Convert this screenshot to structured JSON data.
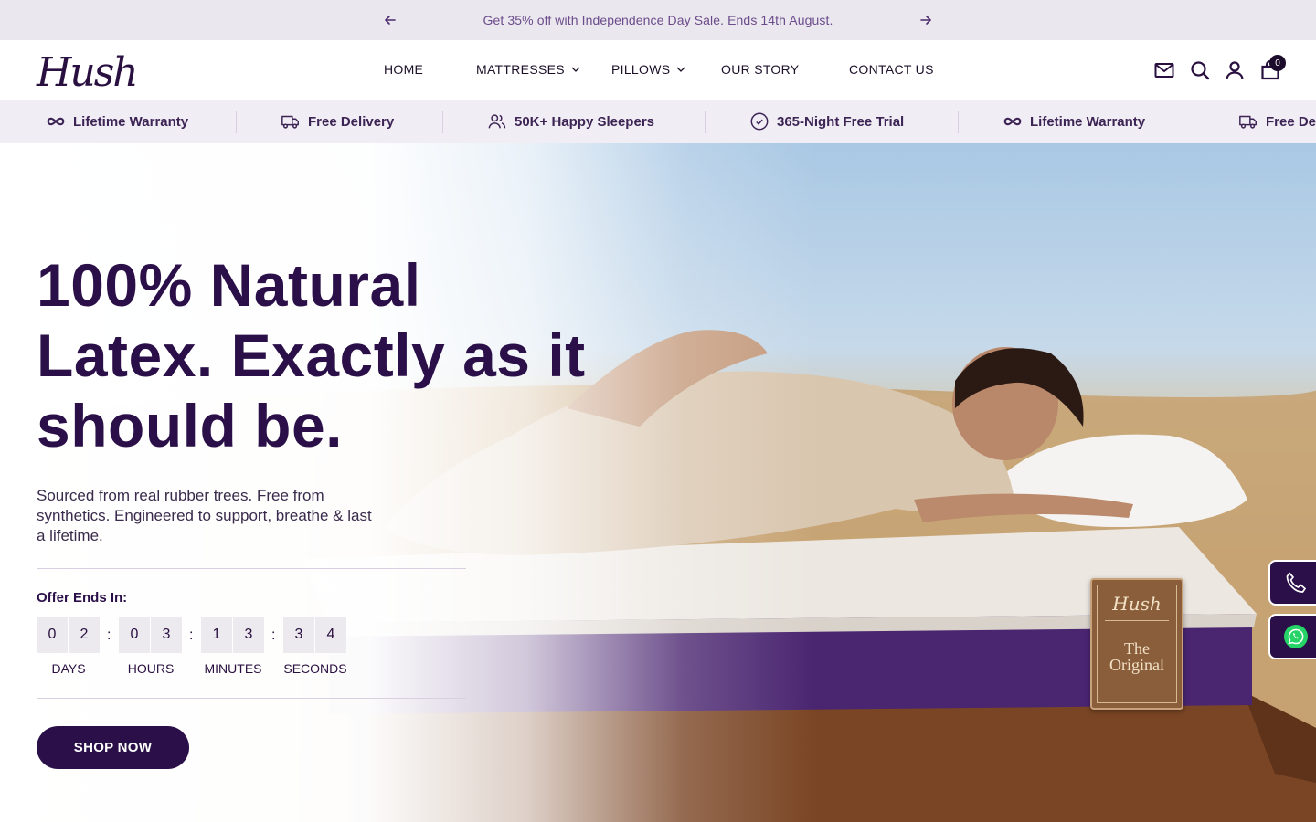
{
  "announcement": {
    "text": "Get 35% off with Independence Day Sale. Ends 14th August.",
    "prev_icon": "arrow-left-icon",
    "next_icon": "arrow-right-icon"
  },
  "header": {
    "logo": "Hush",
    "nav": [
      {
        "label": "HOME"
      },
      {
        "label": "MATTRESSES",
        "has_dropdown": true
      },
      {
        "label": "PILLOWS",
        "has_dropdown": true
      },
      {
        "label": "OUR STORY"
      },
      {
        "label": "CONTACT US"
      }
    ],
    "icons": [
      "mail-icon",
      "search-icon",
      "account-icon",
      "cart-icon"
    ],
    "cart_count": "0"
  },
  "benefits": [
    {
      "label": "Lifetime Warranty",
      "icon": "infinity-icon"
    },
    {
      "label": "Free Delivery",
      "icon": "truck-icon"
    },
    {
      "label": "50K+ Happy Sleepers",
      "icon": "users-icon"
    },
    {
      "label": "365-Night Free Trial",
      "icon": "check-circle-icon"
    },
    {
      "label": "Lifetime Warranty",
      "icon": "infinity-icon"
    },
    {
      "label": "Free De",
      "icon": "truck-icon"
    }
  ],
  "hero": {
    "headline": "100% Natural Latex. Exactly as it should be.",
    "subcopy": "Sourced from real rubber trees. Free from synthetics. Engineered to support, breathe & last a lifetime.",
    "offer_label": "Offer Ends In:",
    "countdown": {
      "days": [
        "0",
        "2"
      ],
      "hours": [
        "0",
        "3"
      ],
      "minutes": [
        "1",
        "3"
      ],
      "seconds": [
        "3",
        "4"
      ],
      "separator": ":",
      "labels": {
        "days": "DAYS",
        "hours": "HOURS",
        "minutes": "MINUTES",
        "seconds": "SECONDS"
      }
    },
    "cta": "SHOP NOW",
    "product_tag": {
      "logo": "Hush",
      "line1": "The",
      "line2": "Original"
    }
  },
  "floating": {
    "phone_icon": "phone-icon",
    "whatsapp_icon": "whatsapp-icon"
  },
  "colors": {
    "brand": "#2a0f48",
    "announce_bg": "#ebe7ef",
    "strip_bg": "#f1edf5",
    "whatsapp": "#25d366"
  }
}
